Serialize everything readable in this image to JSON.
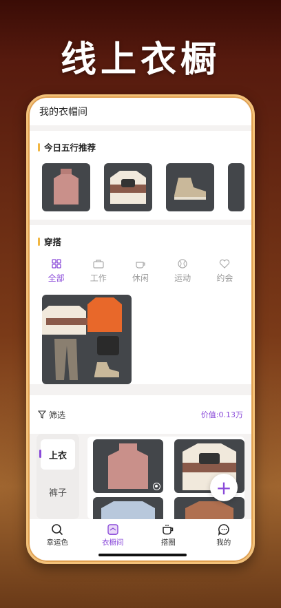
{
  "banner": {
    "title": "线上衣橱"
  },
  "app": {
    "title": "我的衣帽间",
    "recommend": {
      "heading": "今日五行推荐",
      "items": [
        "pink-turtleneck",
        "cream-sweatshirt",
        "khaki-boots",
        "partial-item"
      ]
    },
    "outfits": {
      "heading": "穿搭",
      "tabs": [
        {
          "label": "全部",
          "icon": "grid-icon",
          "active": true
        },
        {
          "label": "工作",
          "icon": "briefcase-icon",
          "active": false
        },
        {
          "label": "休闲",
          "icon": "coffee-icon",
          "active": false
        },
        {
          "label": "运动",
          "icon": "ball-icon",
          "active": false
        },
        {
          "label": "约会",
          "icon": "heart-icon",
          "active": false
        }
      ]
    },
    "filter": {
      "label": "筛选",
      "value": "价值:0.13万"
    },
    "categories": [
      {
        "label": "上衣",
        "active": true
      },
      {
        "label": "裤子",
        "active": false
      }
    ],
    "fab_label": "+",
    "nav": [
      {
        "label": "幸运色",
        "icon": "search-icon",
        "active": false
      },
      {
        "label": "衣橱间",
        "icon": "wardrobe-icon",
        "active": true
      },
      {
        "label": "搭圈",
        "icon": "cup-icon",
        "active": false
      },
      {
        "label": "我的",
        "icon": "chat-icon",
        "active": false
      }
    ]
  },
  "colors": {
    "accent": "#8a4ad9",
    "gold": "#f1b642",
    "frame": "#f3c27a"
  }
}
